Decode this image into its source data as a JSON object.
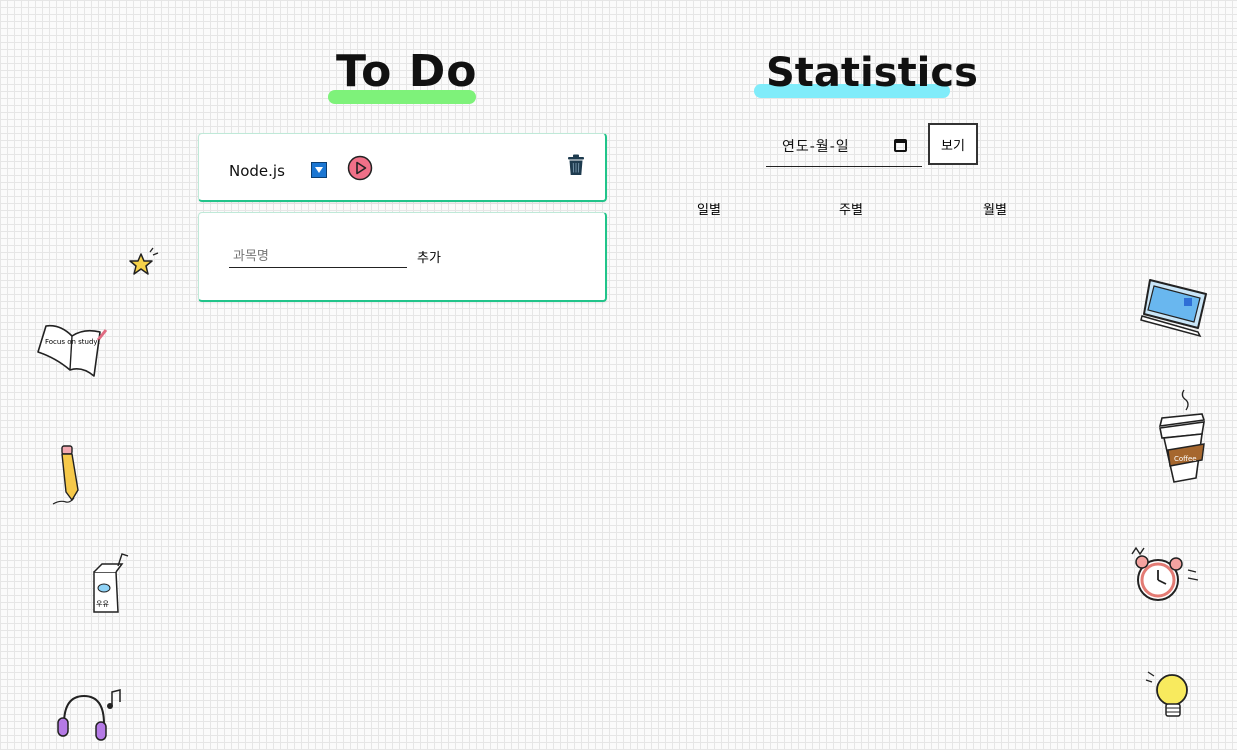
{
  "todo": {
    "title": "To Do",
    "items": [
      {
        "subject": "Node.js"
      }
    ],
    "add_form": {
      "placeholder": "과목명",
      "add_label": "추가"
    }
  },
  "statistics": {
    "title": "Statistics",
    "date_placeholder": "연도-월-일",
    "view_label": "보기",
    "tabs": [
      "일별",
      "주별",
      "월별"
    ]
  },
  "colors": {
    "todo_highlight": "#7ef27a",
    "stats_highlight": "#80ecfa",
    "card_border": "#21c48a",
    "play_button": "#f07088"
  },
  "icons": [
    "dropdown-icon",
    "play-icon",
    "trash-icon",
    "calendar-icon"
  ],
  "doodles": [
    "star-doodle",
    "open-book-doodle",
    "pencil-doodle",
    "juice-box-doodle",
    "headphones-doodle",
    "laptop-doodle",
    "coffee-cup-doodle",
    "alarm-clock-doodle",
    "lightbulb-doodle"
  ],
  "doodle_text": {
    "book": "Focus on study!",
    "coffee": "Coffee",
    "juice": "우유"
  }
}
